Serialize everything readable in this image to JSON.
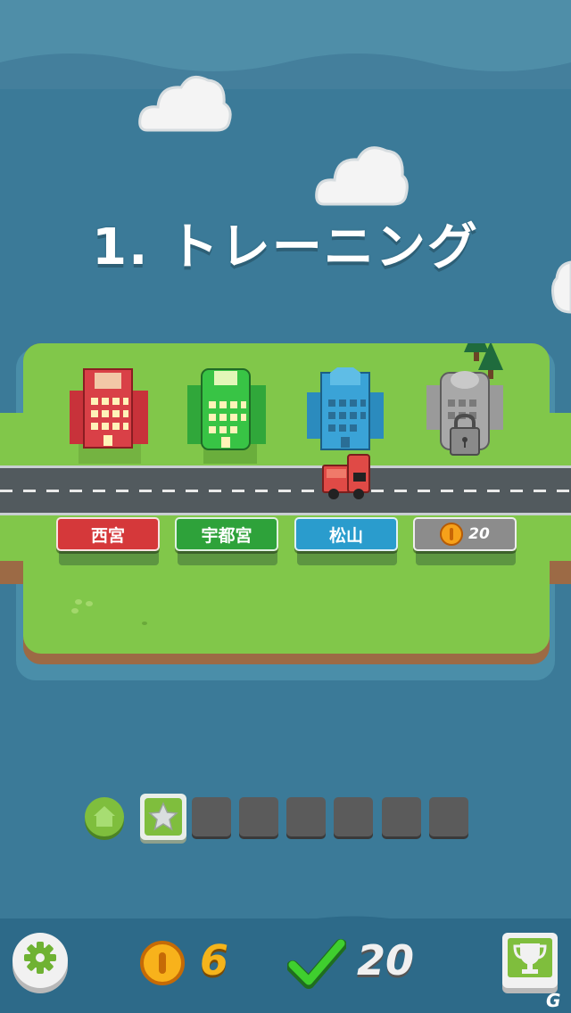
{
  "stage": {
    "title": "1. トレーニング"
  },
  "cities": [
    {
      "label": "西宮",
      "color": "#d5383a",
      "locked": false
    },
    {
      "label": "宇都宮",
      "color": "#2ea23a",
      "locked": false
    },
    {
      "label": "松山",
      "color": "#2a9ccd",
      "locked": false
    },
    {
      "label": "20",
      "color": "#8c8c8c",
      "locked": true,
      "price_icon": "coin-icon"
    }
  ],
  "progress": {
    "home_icon": "home-icon",
    "current_icon": "star-icon",
    "total_slots": 7,
    "filled_slots": 0
  },
  "footer": {
    "settings_icon": "gear-icon",
    "coins": "6",
    "cleared": "20",
    "check_icon": "checkmark-icon",
    "trophy_icon": "trophy-icon"
  },
  "watermark": "G"
}
